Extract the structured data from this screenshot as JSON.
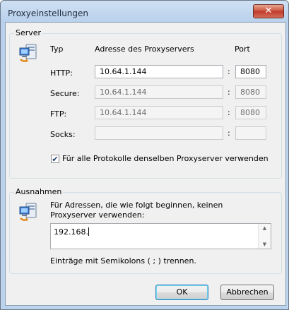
{
  "window": {
    "title": "Proxyeinstellungen",
    "close_glyph": "✕"
  },
  "server": {
    "group_label": "Server",
    "icon": "network-computer-icon",
    "col_type": "Typ",
    "col_address": "Adresse des Proxyservers",
    "col_port": "Port",
    "rows": [
      {
        "label": "HTTP:",
        "address": "10.64.1.144",
        "port": "8080",
        "enabled": true
      },
      {
        "label": "Secure:",
        "address": "10.64.1.144",
        "port": "8080",
        "enabled": false
      },
      {
        "label": "FTP:",
        "address": "10.64.1.144",
        "port": "8080",
        "enabled": false
      },
      {
        "label": "Socks:",
        "address": "",
        "port": "",
        "enabled": false
      }
    ],
    "colon": ":",
    "same_proxy_checked": true,
    "same_proxy_label": "Für alle Protokolle denselben Proxyserver verwenden"
  },
  "exceptions": {
    "group_label": "Ausnahmen",
    "icon": "network-computer-icon",
    "description": "Für Adressen, die wie folgt beginnen, keinen Proxyserver verwenden:",
    "value": "192.168.",
    "hint": "Einträge mit Semikolons ( ; ) trennen."
  },
  "buttons": {
    "ok": "OK",
    "cancel": "Abbrechen"
  }
}
